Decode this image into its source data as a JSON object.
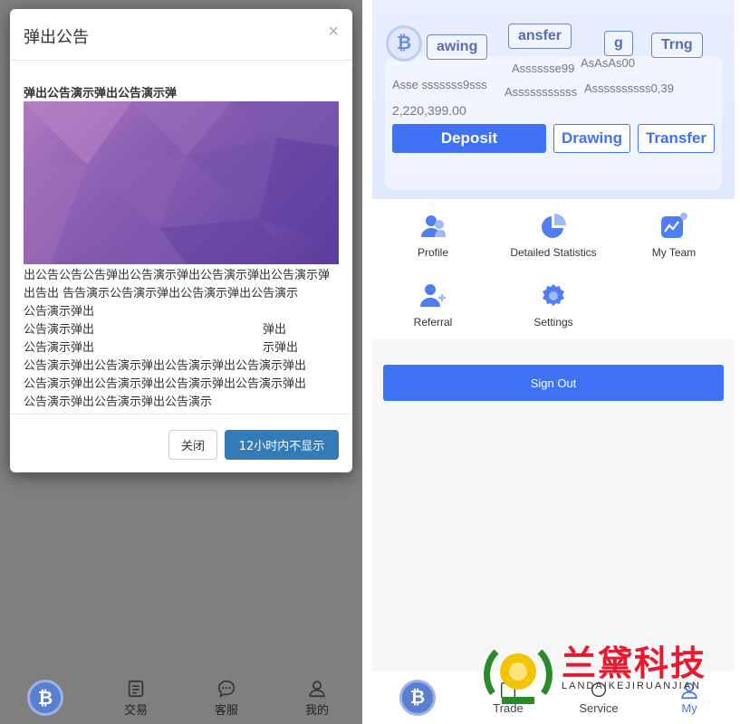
{
  "left": {
    "modal": {
      "title": "弹出公告",
      "close_glyph": "×",
      "headline": "弹出公告演示弹出公告演示弹",
      "body_lines": [
        "出公告公告公告弹出公告演示弹出公告演示弹出公告演示弹",
        "出告出    告告演示公告演示弹出公告演示弹出公告演示",
        "公告演示弹出",
        "公告演示弹出                                             弹出",
        "公告演示弹出                                             示弹出",
        "公告演示弹出公告演示弹出公告演示弹出公告演示弹出",
        "公告演示弹出公告演示弹出公告演示弹出公告演示弹出",
        "公告演示弹出公告演示弹出公告演示"
      ],
      "close_label": "关闭",
      "hide_label": "12小时内不显示"
    },
    "tabbar": [
      {
        "label": "",
        "icon": "bitcoin-icon"
      },
      {
        "label": "交易",
        "icon": "document-icon"
      },
      {
        "label": "客服",
        "icon": "chat-icon"
      },
      {
        "label": "我的",
        "icon": "user-icon"
      }
    ]
  },
  "right": {
    "header": {
      "ghost_buttons": [
        "awing",
        "ansfer",
        "g",
        "Trng"
      ],
      "ghost_texts": [
        "Asssssse99",
        "AsAsAs00",
        "Asse sssssss9sss",
        "Asssssssssss",
        "Assssssssss0,39"
      ],
      "balance": "2,220,399.00",
      "deposit_label": "Deposit",
      "drawing_label": "Drawing",
      "transfer_label": "Transfer"
    },
    "menu": [
      {
        "label": "Profile",
        "icon": "profile-icon"
      },
      {
        "label": "Detailed Statistics",
        "icon": "pie-chart-icon"
      },
      {
        "label": "My Team",
        "icon": "team-chart-icon"
      },
      {
        "label": "Referral",
        "icon": "add-user-icon"
      },
      {
        "label": "Settings",
        "icon": "gear-icon"
      }
    ],
    "sign_out_label": "Sign Out",
    "tabbar": [
      {
        "label": "",
        "icon": "bitcoin-icon"
      },
      {
        "label": "Trade",
        "icon": "trade-icon"
      },
      {
        "label": "Service",
        "icon": "chat-icon"
      },
      {
        "label": "My",
        "icon": "user-icon"
      }
    ]
  },
  "watermark": {
    "name": "兰黛科技",
    "subtitle": "LANDAIKEJIRUANJIAN"
  },
  "colors": {
    "primary": "#3f72f5",
    "modal_button": "#337ab7",
    "overlay": "#7f7f7f",
    "watermark_red": "#e8192c"
  }
}
